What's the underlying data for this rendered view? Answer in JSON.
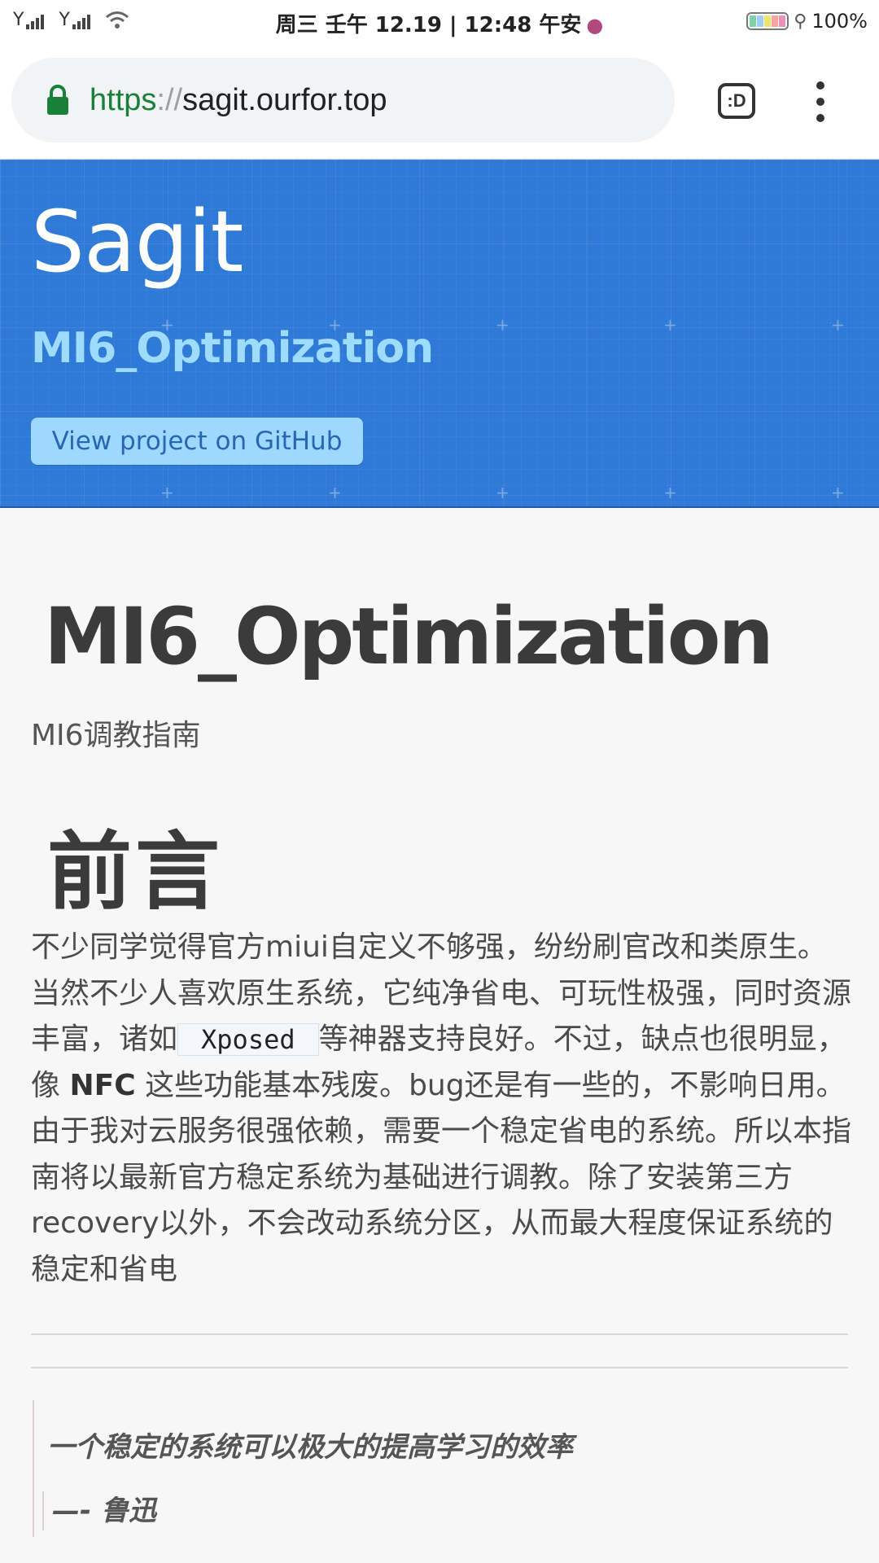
{
  "status_bar": {
    "signal_1_icon": "signal-icon",
    "signal_2_icon": "signal-icon",
    "wifi_icon": "wifi-icon",
    "datetime": "周三 壬午 12.19 | 12:48 午安",
    "battery_percent": "100%",
    "battery_level": 1.0
  },
  "browser": {
    "url_scheme": "https",
    "url_separator": "://",
    "url_host": "sagit.ourfor.top",
    "tab_button_label": ":D",
    "menu_icon": "more-vert-icon",
    "lock_icon": "lock-icon",
    "lock_color": "#188038"
  },
  "header": {
    "title": "Sagit",
    "subtitle": "MI6_Optimization",
    "github_button": "View project on GitHub",
    "background_color": "#2f7ad6",
    "button_color": "#9fd8ff"
  },
  "main": {
    "heading": "MI6_Optimization",
    "tagline": "MI6调教指南",
    "section_heading": "前言",
    "paragraph": {
      "part1": "不少同学觉得官方miui自定义不够强，纷纷刷官改和类原生。当然不少人喜欢原生系统，它纯净省电、可玩性极强，同时资源丰富，诸如",
      "code": "Xposed",
      "part2": "等神器支持良好。不过，缺点也很明显，像",
      "bold": "NFC",
      "part3": "这些功能基本残废。bug还是有一些的，不影响日用。由于我对云服务很强依赖，需要一个稳定省电的系统。所以本指南将以最新官方稳定系统为基础进行调教。除了安装第三方recovery以外，不会改动系统分区，从而最大程度保证系统的稳定和省电"
    },
    "quote": {
      "text": "一个稳定的系统可以极大的提高学习的效率",
      "author": "—- 鲁迅"
    }
  }
}
